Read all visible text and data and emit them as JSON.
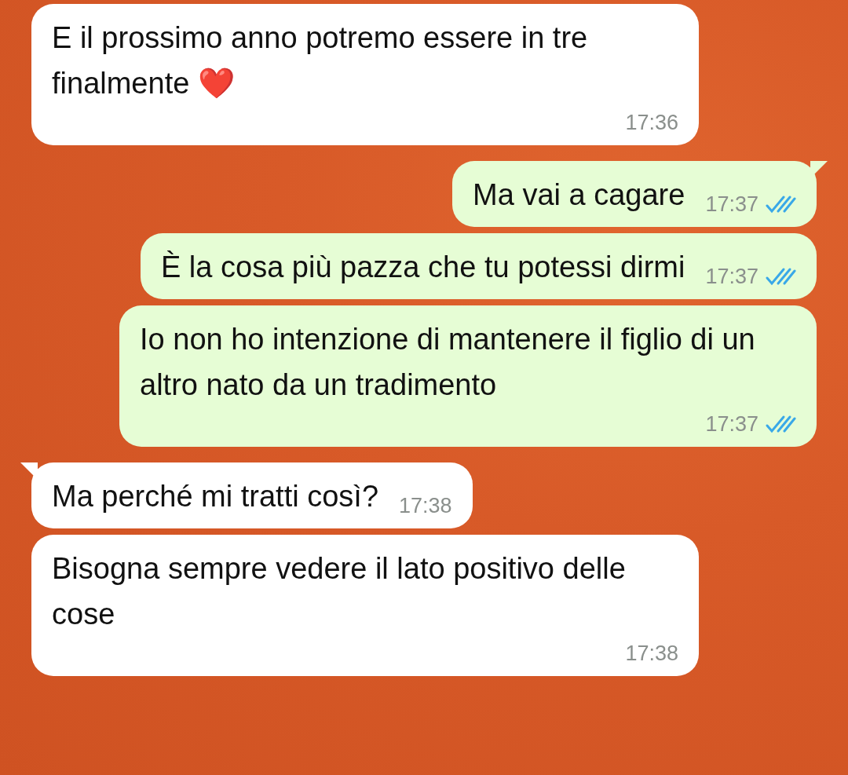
{
  "messages": [
    {
      "kind": "incoming",
      "tail": false,
      "text": "E il prossimo anno potremo essere in tre finalmente ❤️",
      "time": "17:36"
    },
    {
      "kind": "outgoing",
      "tail": true,
      "text": "Ma vai a cagare",
      "time": "17:37",
      "read": true
    },
    {
      "kind": "outgoing",
      "tail": false,
      "text": "È la cosa più pazza che tu potessi dirmi",
      "time": "17:37",
      "read": true
    },
    {
      "kind": "outgoing",
      "tail": false,
      "text": "Io non ho intenzione di mantenere il figlio di un altro nato da un tradimento",
      "time": "17:37",
      "read": true
    },
    {
      "kind": "incoming",
      "tail": true,
      "text": "Ma perché mi tratti così?",
      "time": "17:38"
    },
    {
      "kind": "incoming",
      "tail": false,
      "text": "Bisogna sempre vedere il lato positivo delle cose",
      "time": "17:38"
    }
  ]
}
